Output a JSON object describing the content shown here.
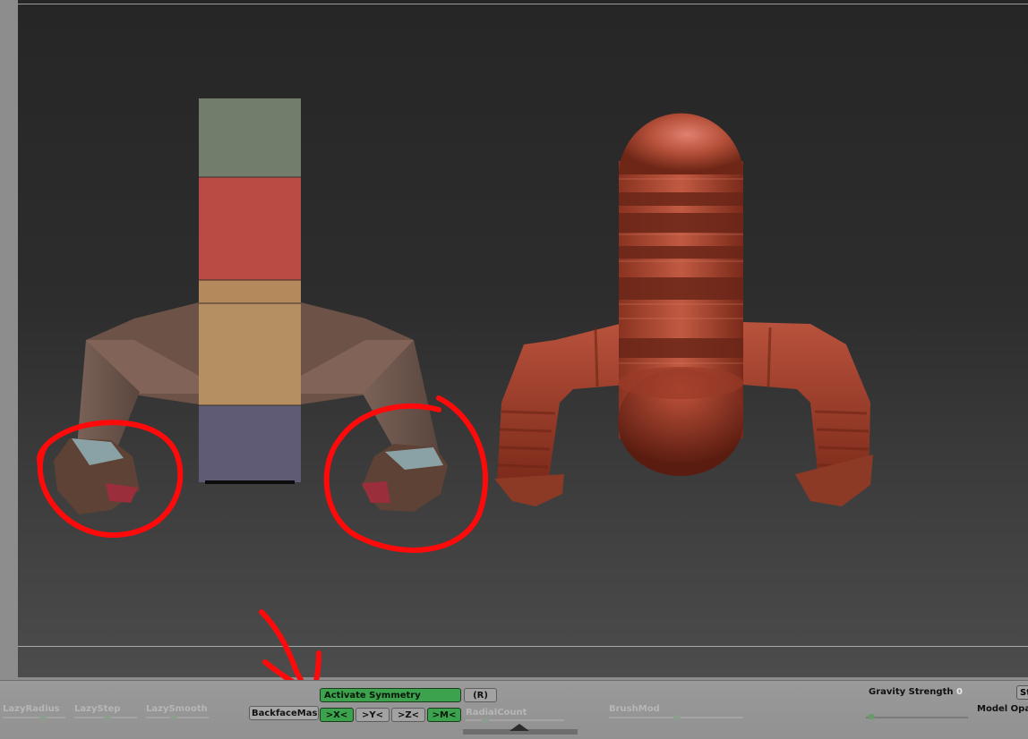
{
  "toolbar": {
    "lazy_radius": "LazyRadius",
    "lazy_step": "LazyStep",
    "lazy_smooth": "LazySmooth",
    "backface_mask": "BackfaceMas",
    "activate_symmetry": "Activate Symmetry",
    "radial_shortcut": "(R)",
    "axis_x": ">X<",
    "axis_y": ">Y<",
    "axis_z": ">Z<",
    "axis_m": ">M<",
    "radial_count": "RadialCount",
    "brush_mod": "BrushMod",
    "gravity_strength": "Gravity Strength",
    "gravity_value": "0",
    "model_opacity": "Model Opa",
    "st_button": "St"
  },
  "state": {
    "activate_symmetry_on": true,
    "axis_x_on": true,
    "axis_y_on": false,
    "axis_z_on": false,
    "axis_m_on": true
  },
  "colors": {
    "active_green": "#3ca24d",
    "annotation_red": "#ff0a0a",
    "toolbar_gray": "#9a9a9a"
  }
}
